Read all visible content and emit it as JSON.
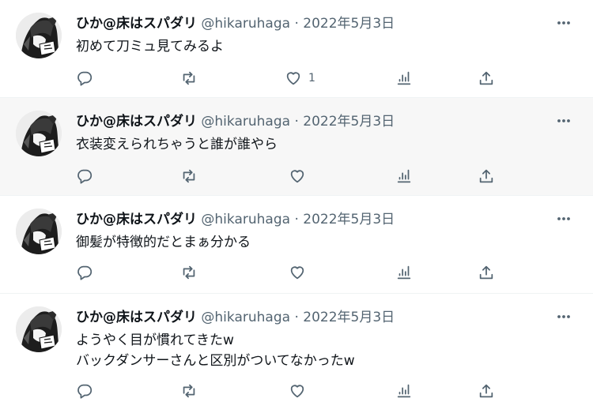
{
  "user": {
    "display_name": "ひか@床はスパダリ",
    "handle": "@hikaruhaga",
    "separator": "·"
  },
  "tweets": [
    {
      "date": "2022年5月3日",
      "text": "初めて刀ミュ見てみるよ",
      "like_count": "1"
    },
    {
      "date": "2022年5月3日",
      "text": "衣装変えられちゃうと誰が誰やら",
      "like_count": ""
    },
    {
      "date": "2022年5月3日",
      "text": "御髪が特徴的だとまぁ分かる",
      "like_count": ""
    },
    {
      "date": "2022年5月3日",
      "text": "ようやく目が慣れてきたw\nバックダンサーさんと区別がついてなかったw",
      "like_count": ""
    }
  ],
  "icons": [
    "more-icon",
    "reply-icon",
    "retweet-icon",
    "like-icon",
    "views-icon",
    "share-icon"
  ],
  "colors": {
    "secondary_text": "#536471",
    "highlight_bg": "#f7f7f7",
    "border": "#eff3f4"
  }
}
